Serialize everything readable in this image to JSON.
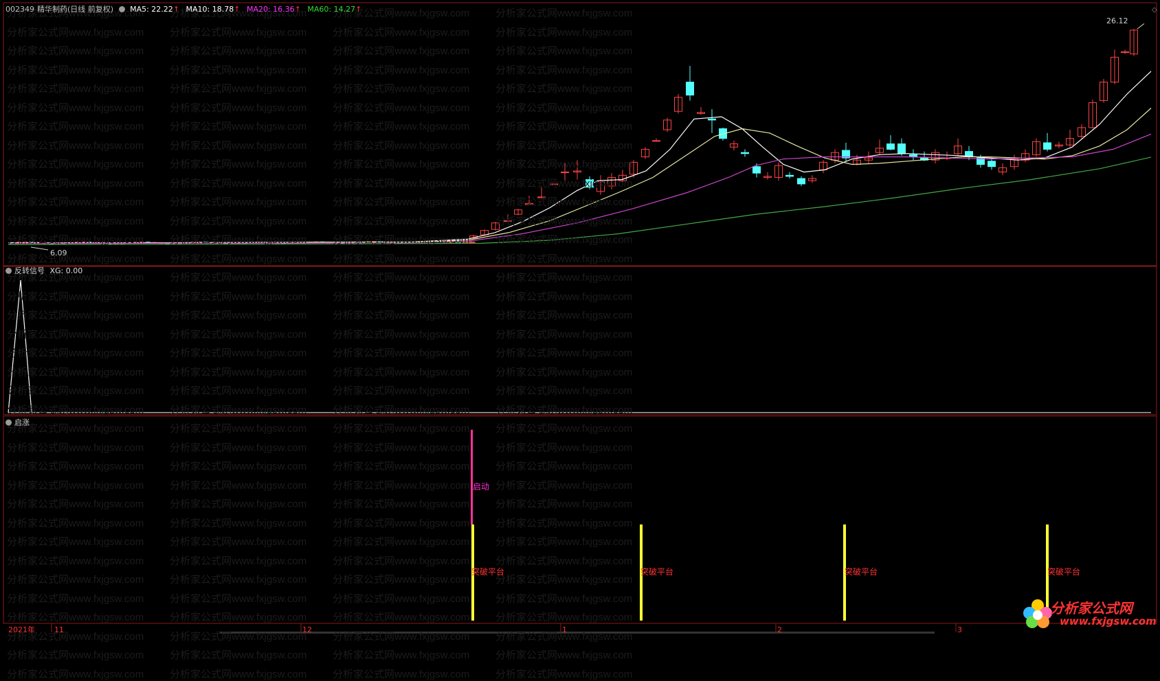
{
  "header": {
    "code": "002349",
    "name": "精华制药",
    "period": "(日线 前复权)",
    "ma": [
      {
        "label": "MA5: 22.22",
        "color": "#ffffff"
      },
      {
        "label": "MA10: 18.78",
        "color": "#ffffff"
      },
      {
        "label": "MA20: 16.36",
        "color": "#ff33ff"
      },
      {
        "label": "MA60: 14.27",
        "color": "#33dd33"
      }
    ],
    "up_arrow": "↑"
  },
  "price_panel": {
    "high_label": "26.12",
    "low_label": "6.09"
  },
  "indicator1": {
    "title": "反转信号",
    "value": "XG: 0.00"
  },
  "indicator2": {
    "title": "启涨",
    "start_label": "启动",
    "breakout_label": "突破平台"
  },
  "time_axis": [
    "2021年",
    "11",
    "12",
    "1",
    "2",
    "3"
  ],
  "watermark_text": "分析家公式网www.fxjgsw.com",
  "logo": {
    "title": "分析家公式网",
    "url": "www.fxjgsw.com"
  },
  "colors": {
    "border": "#8b1a1a",
    "up_candle": "#ff4444",
    "down_candle": "#54ffff",
    "ma5": "#ffffff",
    "ma10": "#e8e8a0",
    "ma20": "#cc44cc",
    "ma60": "#44aa44",
    "signal_start": "#ff3399",
    "signal_breakout": "#ffff33"
  }
}
